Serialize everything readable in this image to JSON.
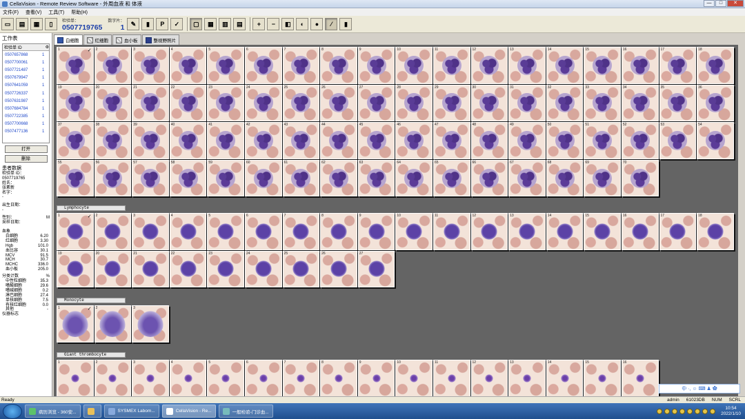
{
  "window": {
    "title": "CellaVision - Remote Review Software - 外周血液 和 体液",
    "min": "—",
    "max": "□",
    "close": "✕"
  },
  "menu": [
    "文件(F)",
    "查看(V)",
    "工具(T)",
    "帮助(H)"
  ],
  "toolbar": {
    "sample_label": "检验单：",
    "sample_value": "0507719765",
    "count_label": "数字片：",
    "count_value": "1"
  },
  "left": {
    "worklist_title": "工作表",
    "col_header": "检验单 ID",
    "col_flag": "⚙",
    "rows": [
      {
        "id": "0507657868",
        "n": "1"
      },
      {
        "id": "0507700061",
        "n": "1"
      },
      {
        "id": "0507721487",
        "n": "1"
      },
      {
        "id": "0507679947",
        "n": "1"
      },
      {
        "id": "0507641059",
        "n": "1"
      },
      {
        "id": "0507726337",
        "n": "1"
      },
      {
        "id": "0507631987",
        "n": "1"
      },
      {
        "id": "0507684784",
        "n": "1"
      },
      {
        "id": "0507722385",
        "n": "1"
      },
      {
        "id": "0507700668",
        "n": "1"
      },
      {
        "id": "0507477136",
        "n": "1"
      }
    ],
    "open_btn": "打开",
    "delete_btn": "删除",
    "patient_title": "患者数据",
    "fields": [
      {
        "k": "检验单 ID：",
        "v": ""
      },
      {
        "k": "0507719765",
        "v": ""
      },
      {
        "k": "姓氏：",
        "v": ""
      },
      {
        "k": "张素新",
        "v": ""
      },
      {
        "k": "名字：",
        "v": ""
      },
      {
        "k": "-",
        "v": ""
      }
    ],
    "dob_label": "出生日期：",
    "dob_value": "-",
    "sex_label": "性别：",
    "sex_value": "M",
    "collect_label": "采样日期：",
    "blood_title": "血象",
    "blood": [
      {
        "k": "白细胞",
        "v": "6.20"
      },
      {
        "k": "红细胞",
        "v": "3.30"
      },
      {
        "k": "Hgb",
        "v": "101.0"
      },
      {
        "k": "血比容",
        "v": "30.1"
      },
      {
        "k": "MCV",
        "v": "91.5"
      },
      {
        "k": "MCH",
        "v": "30.7"
      },
      {
        "k": "MCHC",
        "v": "336.0"
      },
      {
        "k": "血小板",
        "v": "205.0"
      }
    ],
    "diff_title": "分类计数",
    "diff_unit": "%",
    "diff": [
      {
        "k": "中性粒细胞",
        "v": "35.3"
      },
      {
        "k": "嗜酸细胞",
        "v": "29.6"
      },
      {
        "k": "嗜碱细胞",
        "v": "0.2"
      },
      {
        "k": "淋巴细胞",
        "v": "27.4"
      },
      {
        "k": "单核细胞",
        "v": "7.5"
      },
      {
        "k": "有核红细胞",
        "v": "0.0"
      },
      {
        "k": "其他",
        "v": "-"
      }
    ],
    "instrument_label": "仪器标志"
  },
  "tabs": [
    "白细胞",
    "红细胞",
    "血小板",
    "整视野照片"
  ],
  "sections": {
    "neut_count": 70,
    "lym_label": "Lymphocyte",
    "lym_count": 27,
    "mono_label": "Monocyte",
    "mono_count": 3,
    "plt_label": "Giant thrombocyte",
    "plt_count": 16
  },
  "status": {
    "left": "Ready",
    "user": "admin",
    "station": "61023DB",
    "num": "NUM",
    "scrl": "SCRL"
  },
  "ime": "中 ·, ☺ ⌨ ♟ ✿",
  "taskbar": {
    "items": [
      "病历浏览 - 360安...",
      "",
      "SYSMEX Labom...",
      "CellaVision - Re...",
      "一般检验-门诊血..."
    ],
    "time": "10:54",
    "date": "2022/1/10"
  }
}
